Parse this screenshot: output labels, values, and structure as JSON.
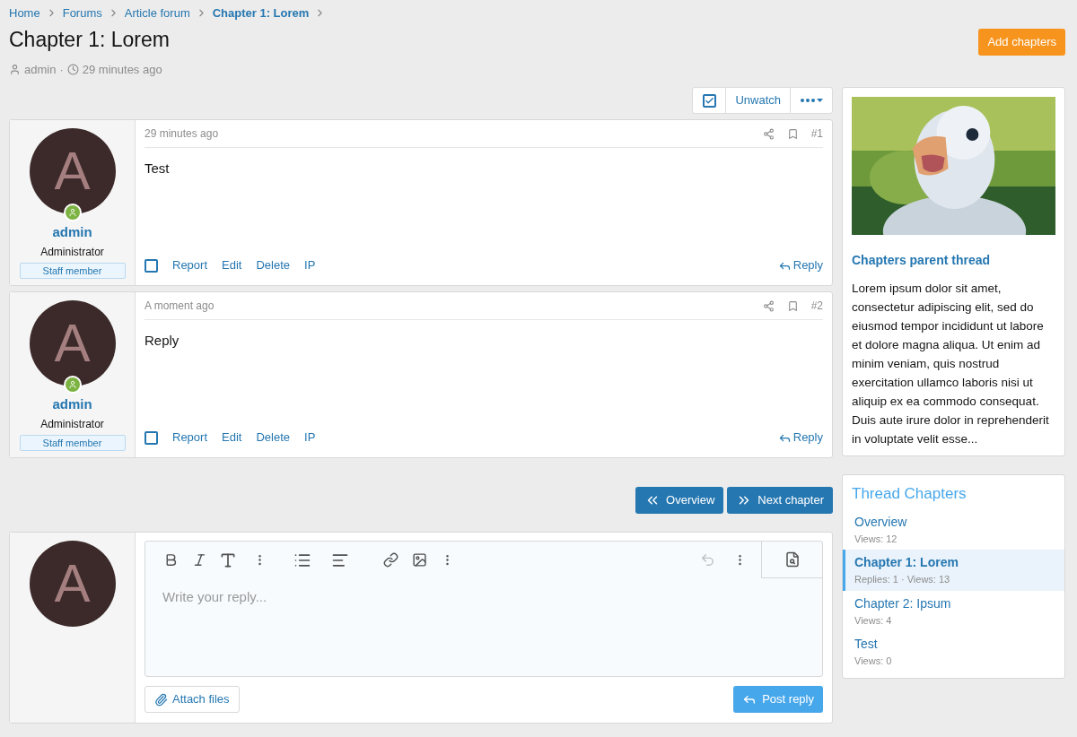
{
  "breadcrumbs": [
    {
      "label": "Home",
      "current": false
    },
    {
      "label": "Forums",
      "current": false
    },
    {
      "label": "Article forum",
      "current": false
    },
    {
      "label": "Chapter 1: Lorem",
      "current": true
    }
  ],
  "title": "Chapter 1: Lorem",
  "meta": {
    "author": "admin",
    "separator": "·",
    "time": "29 minutes ago"
  },
  "add_button": "Add chapters",
  "watch": {
    "checked": true,
    "label": "Unwatch"
  },
  "posts": [
    {
      "avatar_letter": "A",
      "username": "admin",
      "role": "Administrator",
      "badge": "Staff member",
      "time": "29 minutes ago",
      "number": "#1",
      "body": "Test",
      "selected": false,
      "actions": [
        "Report",
        "Edit",
        "Delete",
        "IP"
      ],
      "reply": "Reply"
    },
    {
      "avatar_letter": "A",
      "username": "admin",
      "role": "Administrator",
      "badge": "Staff member",
      "time": "A moment ago",
      "number": "#2",
      "body": "Reply",
      "selected": false,
      "actions": [
        "Report",
        "Edit",
        "Delete",
        "IP"
      ],
      "reply": "Reply"
    }
  ],
  "nav_buttons": [
    {
      "label": "Overview",
      "kind": "back"
    },
    {
      "label": "Next chapter",
      "kind": "forward"
    }
  ],
  "editor": {
    "avatar_letter": "A",
    "placeholder": "Write your reply...",
    "attach": "Attach files",
    "submit": "Post reply"
  },
  "sidebar": {
    "card": {
      "kind": "picture",
      "title": "Chapters parent thread",
      "text": "Lorem ipsum dolor sit amet, consectetur adipiscing elit, sed do eiusmod tempor incididunt ut labore et dolore magna aliqua. Ut enim ad minim veniam, quis nostrud exercitation ullamco laboris nisi ut aliquip ex ea commodo consequat. Duis aute irure dolor in reprehenderit in voluptate velit esse..."
    },
    "chapters_title": "Thread Chapters",
    "chapters": [
      {
        "title": "Overview",
        "stats": "Views: 12",
        "selected": false
      },
      {
        "title": "Chapter 1: Lorem",
        "stats": "Replies: 1 · Views: 13",
        "selected": true
      },
      {
        "title": "Chapter 2: Ipsum",
        "stats": "Views: 4",
        "selected": false
      },
      {
        "title": "Test",
        "stats": "Views: 0",
        "selected": false
      }
    ]
  }
}
